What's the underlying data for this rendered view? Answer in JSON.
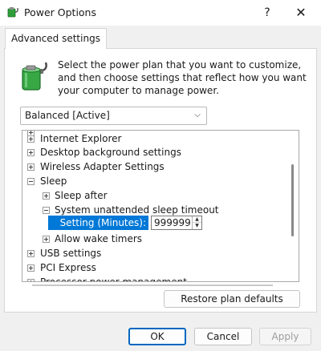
{
  "window": {
    "title": "Power Options",
    "help_label": "?",
    "close_label": "✕"
  },
  "tab": {
    "label": "Advanced settings"
  },
  "intro": {
    "text": "Select the power plan that you want to customize, and then choose settings that reflect how you want your computer to manage power."
  },
  "plan_select": {
    "value": "Balanced [Active]"
  },
  "tree": {
    "items": [
      {
        "label": "",
        "expanded": false
      },
      {
        "label": "Internet Explorer",
        "expanded": false
      },
      {
        "label": "Desktop background settings",
        "expanded": false
      },
      {
        "label": "Wireless Adapter Settings",
        "expanded": false
      },
      {
        "label": "Sleep",
        "expanded": true
      },
      {
        "label": "Sleep after",
        "expanded": false
      },
      {
        "label": "System unattended sleep timeout",
        "expanded": true
      },
      {
        "label": "Allow wake timers",
        "expanded": false
      },
      {
        "label": "USB settings",
        "expanded": false
      },
      {
        "label": "PCI Express",
        "expanded": false
      },
      {
        "label": "Processor power management",
        "expanded": false
      }
    ],
    "setting_label": "Setting (Minutes):",
    "setting_value": "999999"
  },
  "buttons": {
    "restore": "Restore plan defaults",
    "ok": "OK",
    "cancel": "Cancel",
    "apply": "Apply"
  },
  "colors": {
    "selection": "#0078d7",
    "ok_border": "#0067c0"
  },
  "icons": {
    "app": "power-options-icon",
    "battery": "battery-plug-icon",
    "chevron": "chevron-down-icon"
  }
}
